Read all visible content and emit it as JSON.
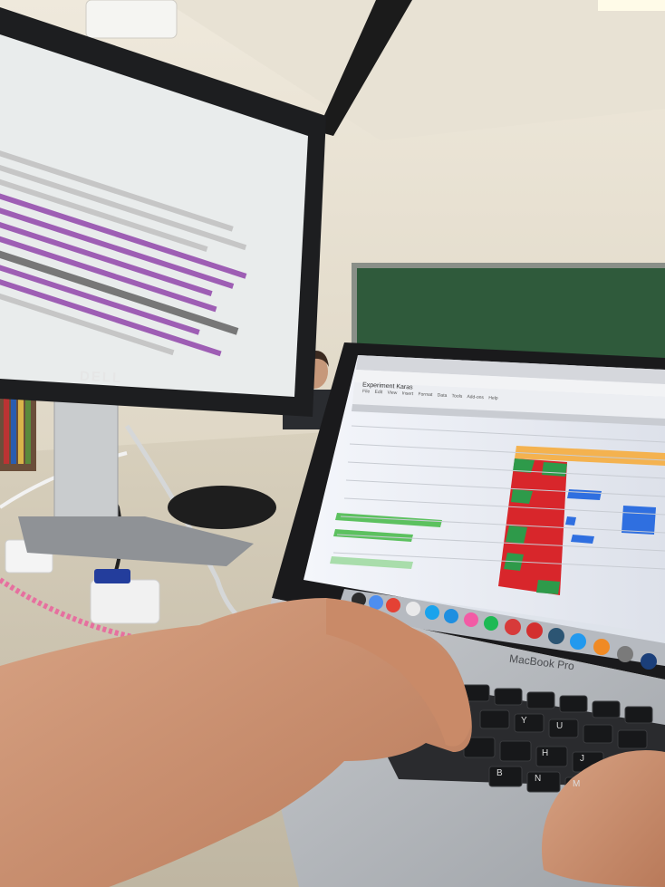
{
  "scene": {
    "monitor_brand": "DELL",
    "laptop_model": "MacBook Pro"
  },
  "spreadsheet": {
    "document_title": "Experiment Karas",
    "menu_items": [
      "File",
      "Edit",
      "View",
      "Insert",
      "Format",
      "Data",
      "Tools",
      "Add-ons",
      "Help"
    ]
  },
  "keyboard": {
    "visible_keys": [
      "Y",
      "U",
      "H",
      "J",
      "N",
      "B",
      "M"
    ]
  },
  "colors": {
    "wall": "#e7e1d3",
    "chalkboard": "#2f5a3b",
    "terminal_bg": "#e9ecec",
    "terminal_purple": "#8b3ba6",
    "sheet_red": "#d8262b",
    "sheet_green": "#2e9a4a",
    "sheet_blue": "#2f6fe0",
    "laptop_body": "#b9bcc0",
    "desk": "#cfc7b4",
    "skin": "#d39a78"
  }
}
